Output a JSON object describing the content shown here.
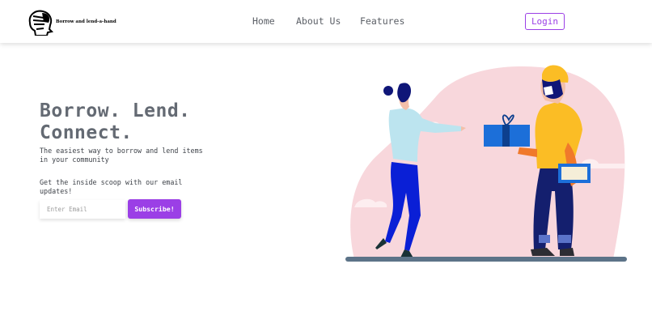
{
  "brand": {
    "name": "Borrow and lend-a-hand",
    "logo_icon": "head-silhouette-icon"
  },
  "nav": {
    "home": "Home",
    "about": "About Us",
    "features": "Features",
    "login": "Login"
  },
  "hero": {
    "title_line1": "Borrow. Lend.",
    "title_line2": "Connect.",
    "subtitle": "The easiest way to borrow and lend items in your community"
  },
  "newsletter": {
    "prompt": "Get the inside scoop with our email updates!",
    "email_placeholder": "Enter Email",
    "email_value": "",
    "subscribe_label": "Subscribe!"
  },
  "colors": {
    "accent": "#9b3fe6",
    "text": "#646a73",
    "blob": "#f8d7dc",
    "ground": "#5c7388"
  }
}
